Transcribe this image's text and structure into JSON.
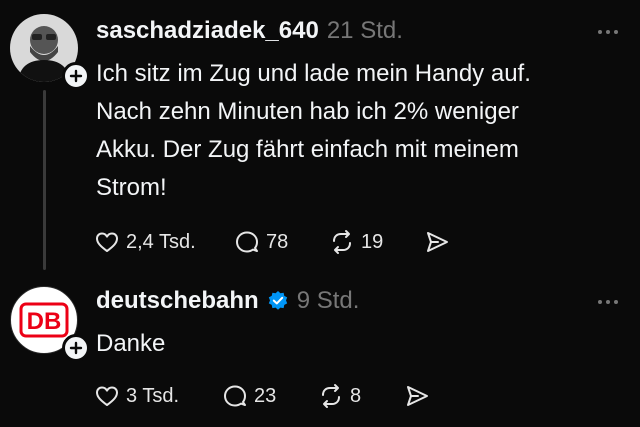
{
  "colors": {
    "background": "#0a0a0a",
    "text": "#f3f5f7",
    "muted": "#777777",
    "verified": "#0095f6",
    "db_red": "#ec0016"
  },
  "posts": [
    {
      "username": "saschadziadek_640",
      "time": "21 Std.",
      "text": "Ich sitz im Zug und lade mein Handy auf.\nNach zehn Minuten hab ich 2% weniger\nAkku. Der Zug fährt einfach mit meinem\nStrom!",
      "likes": "2,4 Tsd.",
      "replies": "78",
      "reposts": "19",
      "icons": [
        "heart-icon",
        "comment-icon",
        "repost-icon",
        "share-icon"
      ]
    },
    {
      "username": "deutschebahn",
      "verified": true,
      "time": "9 Std.",
      "text": "Danke",
      "avatar_text": "DB",
      "likes": "3 Tsd.",
      "replies": "23",
      "reposts": "8",
      "icons": [
        "heart-icon",
        "comment-icon",
        "repost-icon",
        "share-icon"
      ]
    }
  ]
}
